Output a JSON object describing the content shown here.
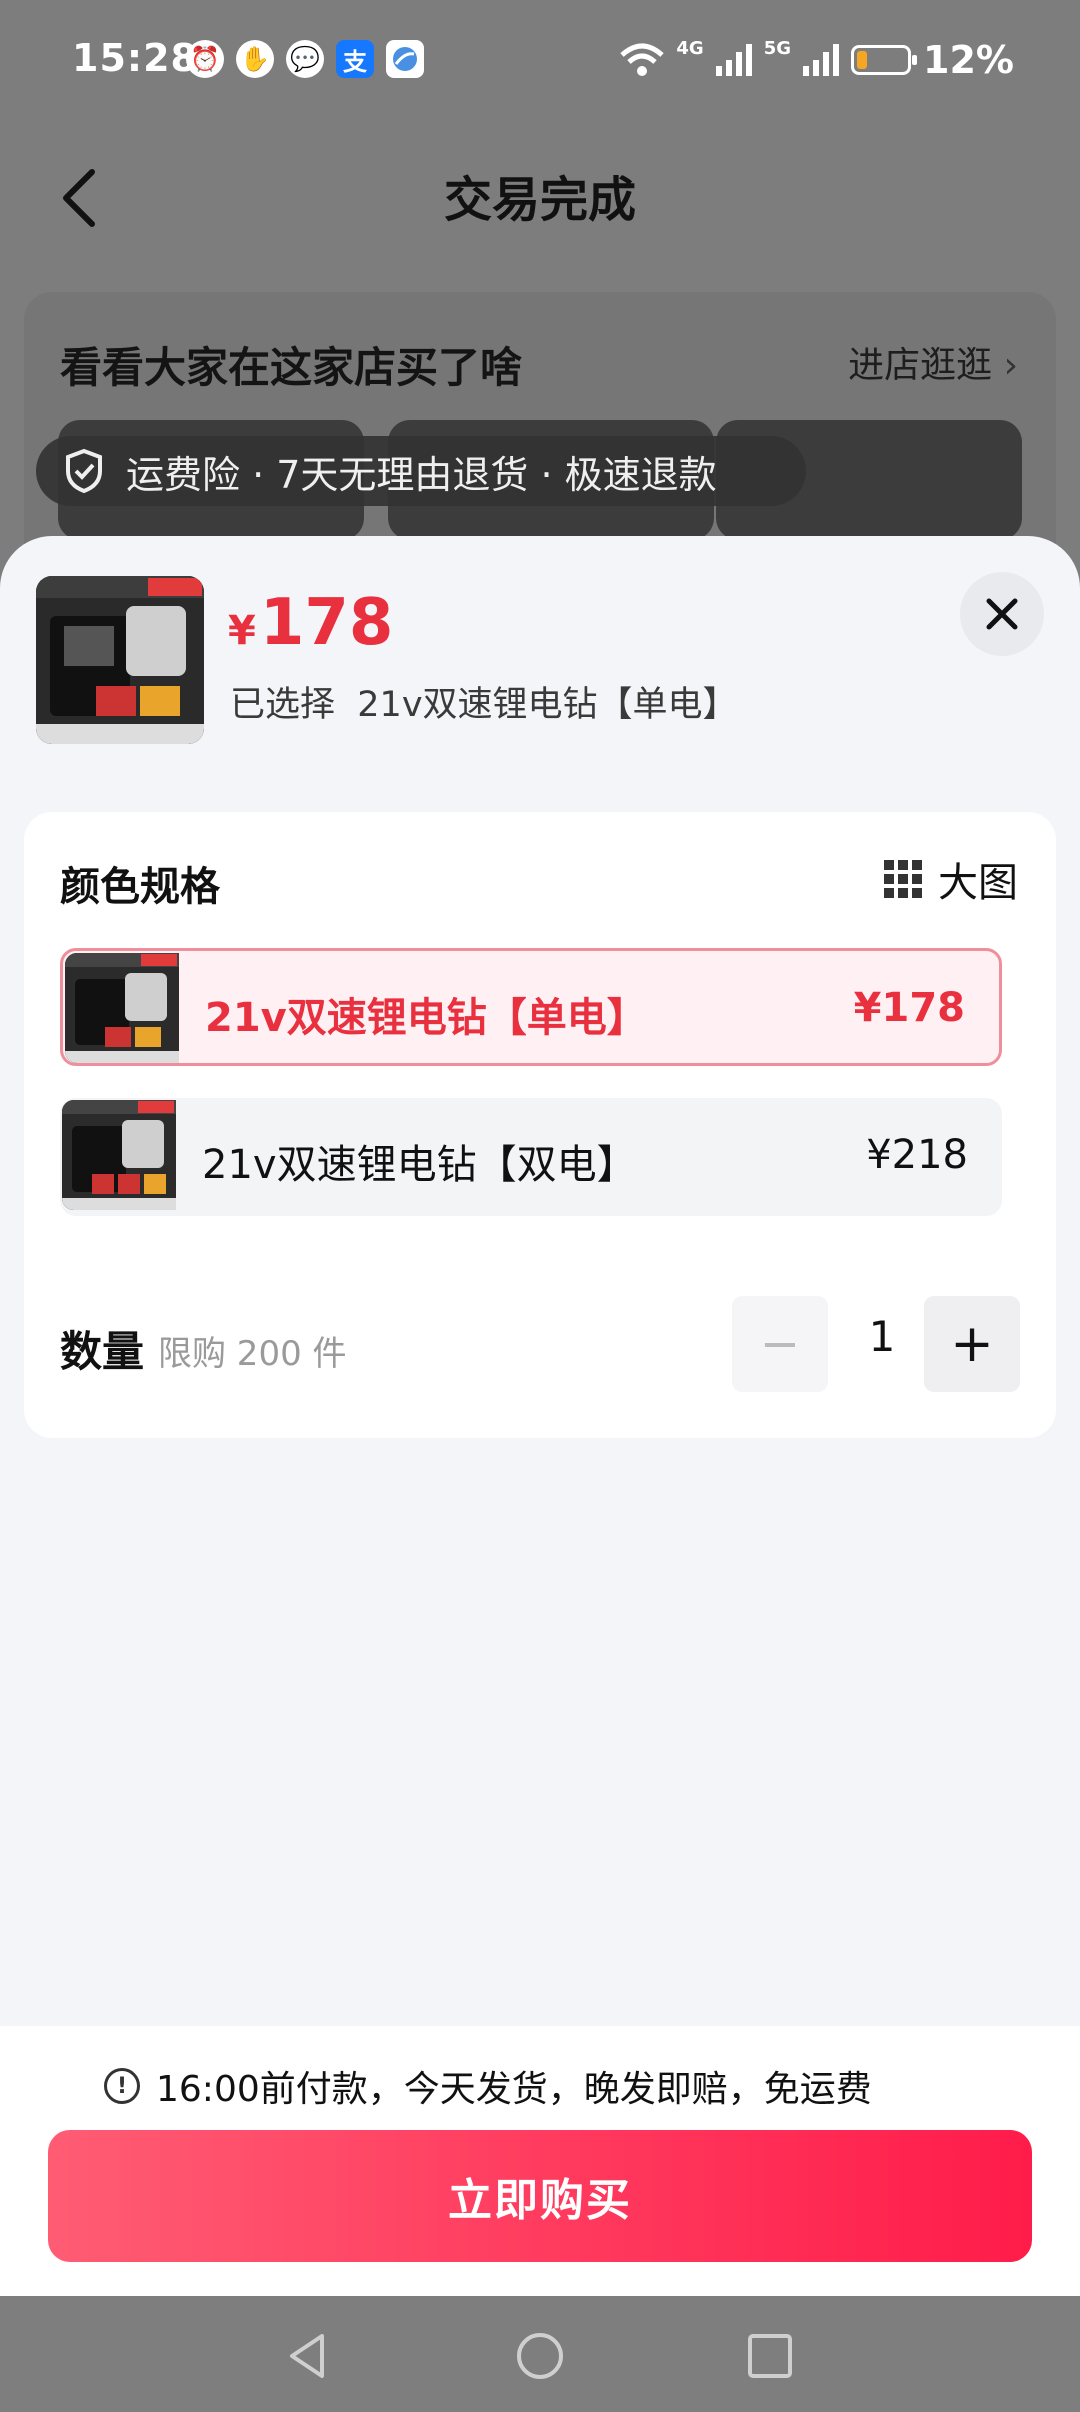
{
  "status_bar": {
    "time": "15:28",
    "net1": "4G",
    "net2": "5G",
    "battery": "12%",
    "app_icons": [
      "alarm-icon",
      "hand-icon",
      "wechat-icon",
      "alipay-icon",
      "browser-icon"
    ],
    "alipay_glyph": "支"
  },
  "background_page": {
    "title": "交易完成",
    "shop_section_title": "看看大家在这家店买了啥",
    "shop_link": "进店逛逛",
    "service_badges": "运费险 · 7天无理由退货 · 极速退款"
  },
  "sheet": {
    "currency": "¥",
    "price": "178",
    "selected_prefix": "已选择",
    "selected_value": "21v双速锂电钻【单电】",
    "spec_title": "颜色规格",
    "big_view_label": "大图",
    "options": [
      {
        "label": "21v双速锂电钻【单电】",
        "price": "¥178",
        "selected": true
      },
      {
        "label": "21v双速锂电钻【双电】",
        "price": "¥218",
        "selected": false
      }
    ],
    "quantity_label": "数量",
    "quantity_limit": "限购 200 件",
    "quantity_minus": "−",
    "quantity_value": "1",
    "quantity_plus": "+",
    "notice_text": "16:00前付款，今天发货，晚发即赔，免运费",
    "buy_button": "立即购买"
  },
  "colors": {
    "accent": "#e8303f",
    "buy_button_start": "#ff5c74",
    "buy_button_end": "#ff1c4a",
    "overlay": "#7d7d7d",
    "sheet_bg": "#f4f5f9"
  }
}
